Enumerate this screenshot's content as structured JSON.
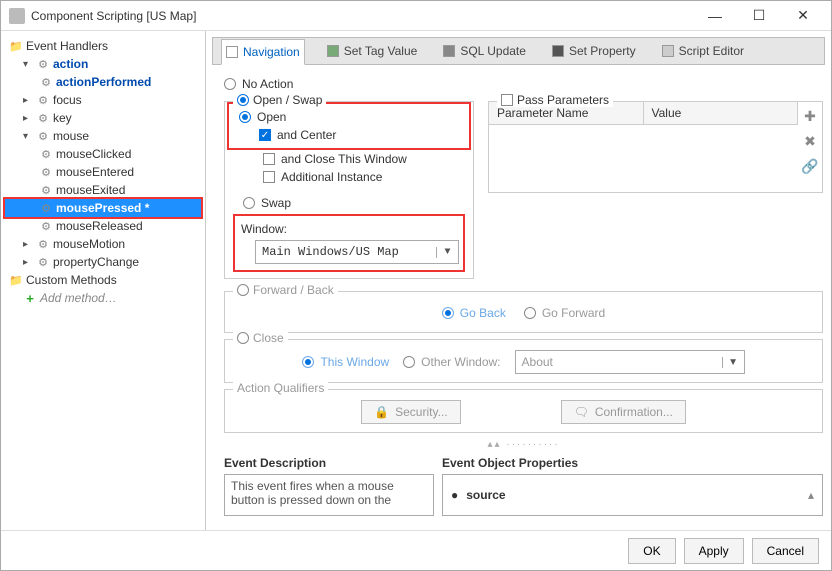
{
  "window": {
    "title": "Component Scripting [US Map]"
  },
  "tree": {
    "root": "Event Handlers",
    "action": "action",
    "actionPerformed": "actionPerformed",
    "focus": "focus",
    "key": "key",
    "mouse": "mouse",
    "mouseClicked": "mouseClicked",
    "mouseEntered": "mouseEntered",
    "mouseExited": "mouseExited",
    "mousePressed": "mousePressed *",
    "mouseReleased": "mouseReleased",
    "mouseMotion": "mouseMotion",
    "propertyChange": "propertyChange",
    "customMethods": "Custom Methods",
    "addMethod": "Add method…"
  },
  "tabs": {
    "navigation": "Navigation",
    "setTagValue": "Set Tag Value",
    "sqlUpdate": "SQL Update",
    "setProperty": "Set Property",
    "scriptEditor": "Script Editor"
  },
  "nav": {
    "noAction": "No Action",
    "openSwap": "Open / Swap",
    "open": "Open",
    "andCenter": "and Center",
    "andCloseThisWindow": "and Close This Window",
    "additionalInstance": "Additional Instance",
    "swap": "Swap",
    "windowLabel": "Window:",
    "windowValue": "Main Windows/US Map",
    "passParameters": "Pass Parameters",
    "paramNameHeader": "Parameter Name",
    "paramValueHeader": "Value",
    "forwardBack": "Forward / Back",
    "goBack": "Go Back",
    "goForward": "Go Forward",
    "close": "Close",
    "thisWindow": "This Window",
    "otherWindow": "Other Window:",
    "otherWindowValue": "About",
    "actionQualifiers": "Action Qualifiers",
    "securityBtn": "Security...",
    "confirmationBtn": "Confirmation..."
  },
  "bottom": {
    "eventDescTitle": "Event Description",
    "eventDescText": "This event fires when a mouse button is pressed down on the",
    "eventPropsTitle": "Event Object Properties",
    "eventPropItem": "source"
  },
  "footer": {
    "ok": "OK",
    "apply": "Apply",
    "cancel": "Cancel"
  }
}
